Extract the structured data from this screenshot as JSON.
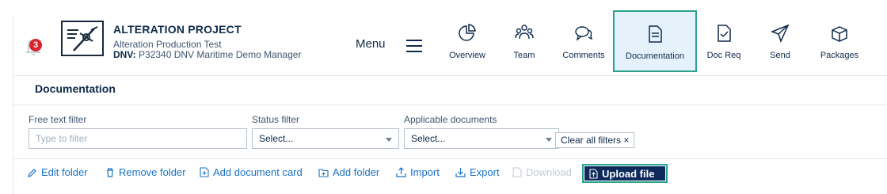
{
  "notifications": {
    "count": "3"
  },
  "project": {
    "title": "ALTERATION PROJECT",
    "subtitle": "Alteration Production Test",
    "dnv_label": "DNV:",
    "dnv_value": "P32340 DNV Maritime Demo Manager"
  },
  "menu": {
    "label": "Menu"
  },
  "nav": [
    {
      "label": "Overview",
      "icon": "pie-chart-icon"
    },
    {
      "label": "Team",
      "icon": "team-icon"
    },
    {
      "label": "Comments",
      "icon": "comments-icon"
    },
    {
      "label": "Documentation",
      "icon": "document-icon",
      "active": true
    },
    {
      "label": "Doc Req",
      "icon": "doc-check-icon"
    },
    {
      "label": "Send",
      "icon": "send-icon"
    },
    {
      "label": "Packages",
      "icon": "package-icon"
    }
  ],
  "section": {
    "title": "Documentation"
  },
  "filters": {
    "free_text_label": "Free text filter",
    "free_text_placeholder": "Type to filter",
    "status_label": "Status filter",
    "status_value": "Select...",
    "applicable_label": "Applicable documents",
    "applicable_value": "Select...",
    "clear_label": "Clear all filters ×"
  },
  "actions": {
    "edit_folder": "Edit folder",
    "remove_folder": "Remove folder",
    "add_document_card": "Add document card",
    "add_folder": "Add folder",
    "import": "Import",
    "export": "Export",
    "download": "Download",
    "upload_file": "Upload file"
  },
  "colors": {
    "accent": "#1a73c7",
    "navy": "#0e2a5c",
    "highlight": "#2aa38d",
    "badge": "#d8242f",
    "active_tab_bg": "#e6f2fb"
  }
}
